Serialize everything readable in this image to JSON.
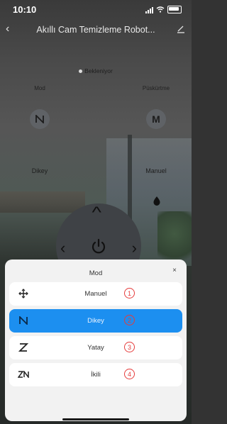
{
  "status_bar": {
    "time": "10:10"
  },
  "nav": {
    "title": "Akıllı Cam Temizleme Robot..."
  },
  "device_status": "Bekleniyor",
  "controls": {
    "mode_label": "Mod",
    "spray_label": "Püskürtme",
    "mode_value": "Dikey",
    "manuel_value": "Manuel",
    "manuel_letter": "M"
  },
  "sheet": {
    "title": "Mod",
    "close": "×",
    "options": [
      {
        "label": "Manuel",
        "number": "1",
        "icon": "move-arrows-icon",
        "selected": false
      },
      {
        "label": "Dikey",
        "number": "2",
        "icon": "n-path-icon",
        "selected": true
      },
      {
        "label": "Yatay",
        "number": "3",
        "icon": "z-path-icon",
        "selected": false
      },
      {
        "label": "İkili",
        "number": "4",
        "icon": "zn-path-icon",
        "selected": false
      }
    ]
  },
  "colors": {
    "accent": "#1c8ff0",
    "badge": "#e53b3b"
  }
}
